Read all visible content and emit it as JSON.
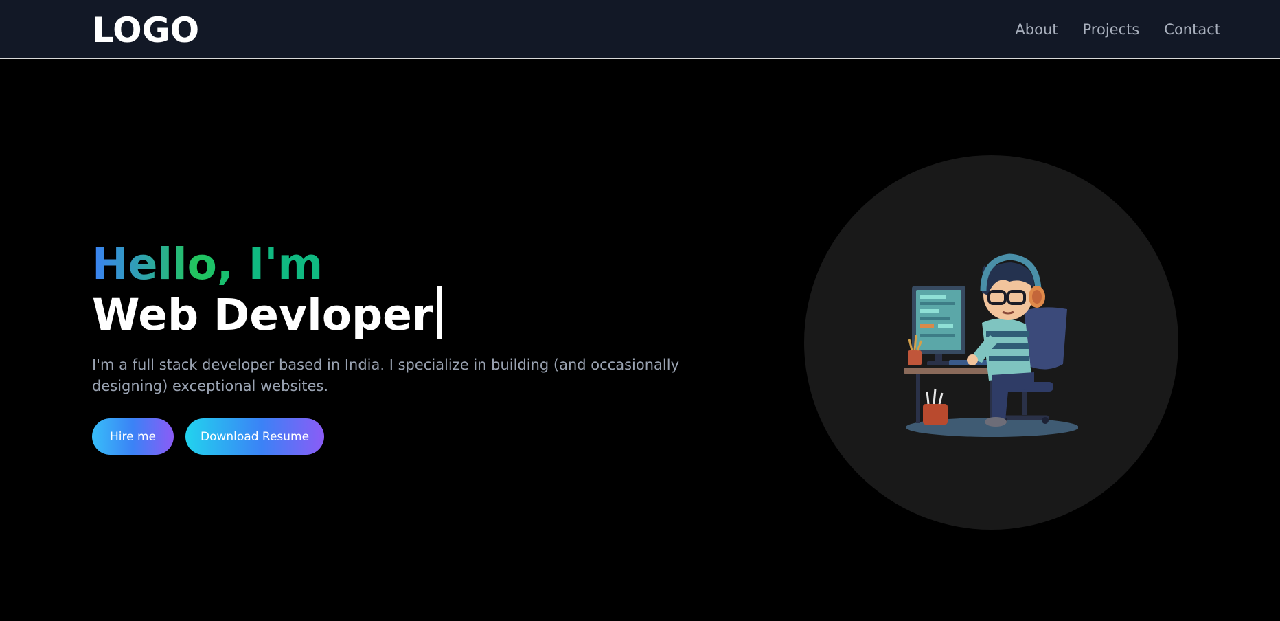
{
  "nav": {
    "logo": "LOGO",
    "links": [
      "About",
      "Projects",
      "Contact"
    ]
  },
  "hero": {
    "greeting": "Hello, I'm",
    "role": "Web Devloper",
    "bio": "I'm a full stack developer based in India. I specialize in building (and occasionally designing) exceptional websites.",
    "buttons": {
      "hire": "Hire me",
      "resume": "Download Resume"
    }
  },
  "colors": {
    "nav_bg": "#121826",
    "page_bg": "#000000",
    "gradient_start": "#3b82f6",
    "gradient_mid": "#22c55e",
    "button_start": "#38bdf8",
    "button_end": "#8b5cf6",
    "avatar_bg": "#191919"
  },
  "icons": {
    "avatar": "developer-at-computer-illustration"
  }
}
